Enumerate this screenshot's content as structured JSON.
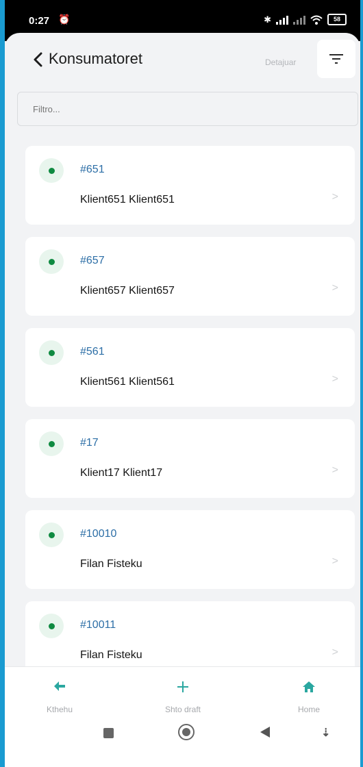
{
  "status_bar": {
    "time": "0:27",
    "battery": "58"
  },
  "header": {
    "title": "Konsumatoret",
    "details_label": "Detajuar"
  },
  "search": {
    "placeholder": "Filtro..."
  },
  "customers": [
    {
      "id": "#651",
      "name": "Klient651 Klient651"
    },
    {
      "id": "#657",
      "name": "Klient657 Klient657"
    },
    {
      "id": "#561",
      "name": "Klient561 Klient561"
    },
    {
      "id": "#17",
      "name": "Klient17 Klient17"
    },
    {
      "id": "#10010",
      "name": "Filan Fisteku"
    },
    {
      "id": "#10011",
      "name": "Filan Fisteku"
    }
  ],
  "bottom_nav": {
    "back_label": "Kthehu",
    "add_label": "Shto draft",
    "home_label": "Home"
  },
  "colors": {
    "accent": "#2aa7a0",
    "status_dot": "#0f8a41",
    "id_text": "#2c6ea6",
    "frame": "#1a9bd1"
  },
  "icons": {
    "back": "chevron-left-icon",
    "filter": "filter-lines-icon",
    "item_chevron": "chevron-right-icon",
    "nav_back": "arrow-left-icon",
    "nav_add": "plus-icon",
    "nav_home": "home-icon"
  }
}
